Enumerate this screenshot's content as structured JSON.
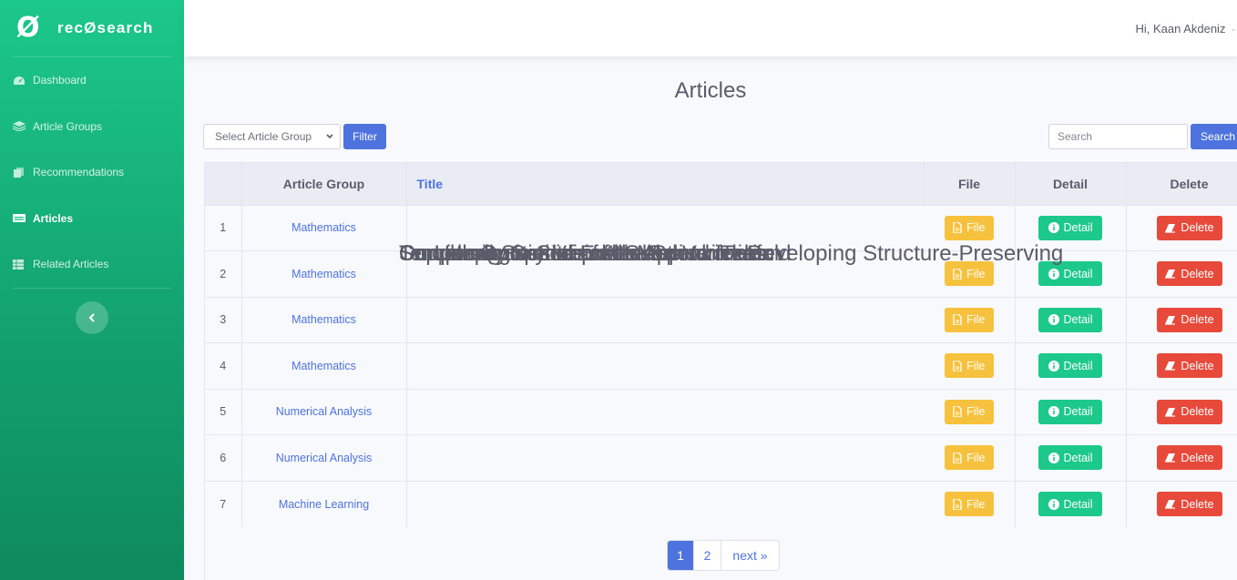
{
  "app": {
    "logo_symbol": "Ø",
    "name": "recØsearch"
  },
  "sidebar": {
    "items": [
      {
        "label": "Dashboard",
        "icon": "tachometer-icon",
        "active": false
      },
      {
        "label": "Article Groups",
        "icon": "layers-icon",
        "active": false
      },
      {
        "label": "Recommendations",
        "icon": "copy-icon",
        "active": false
      },
      {
        "label": "Articles",
        "icon": "id-card-icon",
        "active": true
      },
      {
        "label": "Related Articles",
        "icon": "table-icon",
        "active": false
      }
    ],
    "toggle_icon": "chevron-left-icon"
  },
  "topbar": {
    "greeting": "Hi, Kaan Akdeniz",
    "caret": "⌄"
  },
  "page": {
    "title": "Articles"
  },
  "filter": {
    "select_value": "Select Article Group",
    "button": "Filter"
  },
  "search": {
    "placeholder": "Search",
    "button": "Search"
  },
  "table": {
    "headers": {
      "index": "",
      "group": "Article Group",
      "title": "Title",
      "file": "File",
      "detail": "Detail",
      "delete": "Delete"
    },
    "rows": [
      {
        "n": "1",
        "group": "Mathematics",
        "title": "Concerning q-Summable Szlenk Index",
        "file": "File",
        "detail": "Detail",
        "delete": "Delete"
      },
      {
        "n": "2",
        "group": "Mathematics",
        "title": "On Linear Sections of the Spinor Tenfold",
        "file": "File",
        "detail": "Detail",
        "delete": "Delete"
      },
      {
        "n": "3",
        "group": "Mathematics",
        "title": "On Uniqueness of End Sums",
        "file": "File",
        "detail": "Detail",
        "delete": "Delete"
      },
      {
        "n": "4",
        "group": "Mathematics",
        "title": "Smooth Quotients of Abelian Varieties",
        "file": "File",
        "detail": "Detail",
        "delete": "Delete"
      },
      {
        "n": "5",
        "group": "Numerical Analysis",
        "title": "Supplementary Variable Method for Developing Structure-Preserving",
        "file": "File",
        "detail": "Detail",
        "delete": "Delete"
      },
      {
        "n": "6",
        "group": "Numerical Analysis",
        "title": "Temporally Semidiscrete Approximation",
        "file": "File",
        "detail": "Detail",
        "delete": "Delete"
      },
      {
        "n": "7",
        "group": "Machine Learning",
        "title": "Complexity for deep neural networks",
        "file": "File",
        "detail": "Detail",
        "delete": "Delete"
      }
    ]
  },
  "pagination": {
    "pages": [
      "1",
      "2"
    ],
    "current": "1",
    "next": "next »"
  },
  "colors": {
    "primary": "#4e73df",
    "success": "#1cc88a",
    "warning": "#f6c23e",
    "danger": "#e74a3b"
  }
}
